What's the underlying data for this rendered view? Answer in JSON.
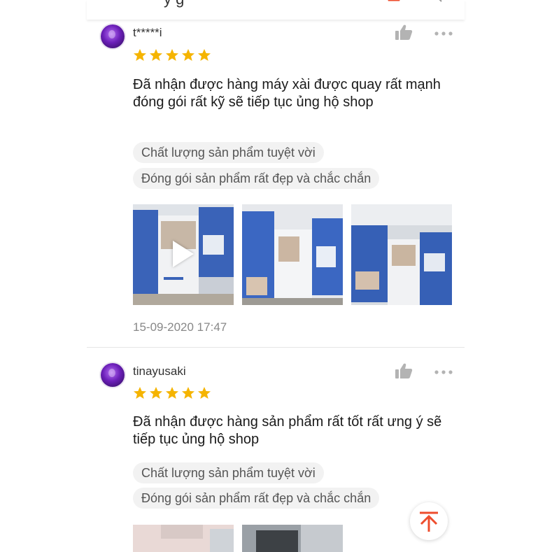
{
  "header": {
    "title_fragment": "y       g",
    "cart_icon": "cart-icon",
    "more_icon": "more-dots-icon"
  },
  "reviews": [
    {
      "username": "t*****i",
      "rating": 5,
      "comment": "Đã nhận được hàng máy xài được quay rất mạnh đóng gói rất kỹ sẽ tiếp tục ủng hộ shop",
      "tags": [
        "Chất lượng sản phẩm tuyệt vời",
        "Đóng gói sản phẩm rất đẹp và chắc chắn"
      ],
      "media_count": 3,
      "date": "15-09-2020 17:47"
    },
    {
      "username": "tinayusaki",
      "rating": 5,
      "comment": "Đã nhận được hàng sản phẩm rất tốt rất ưng ý sẽ tiếp tục ủng hộ shop",
      "tags": [
        "Chất lượng sản phẩm tuyệt vời",
        "Đóng gói sản phẩm rất đẹp và chắc chắn"
      ],
      "media_count": 2
    }
  ],
  "colors": {
    "star": "#f5b400",
    "brand": "#ee4d2d",
    "icon_gray": "#b3b3b3"
  },
  "icons": {
    "like": "thumbs-up-icon",
    "more": "more-dots-icon",
    "play": "play-icon",
    "back_to_top": "arrow-up-to-top-icon"
  }
}
